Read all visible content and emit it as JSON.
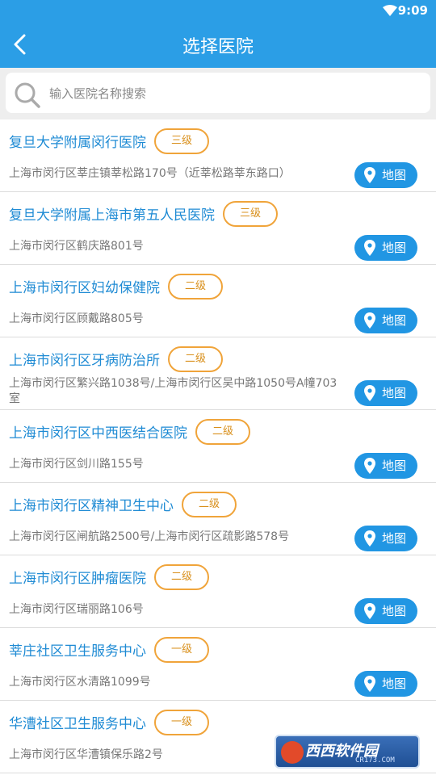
{
  "status_bar": {
    "time": "9:09"
  },
  "header": {
    "title": "选择医院",
    "back_icon": "back-arrow-icon"
  },
  "search": {
    "placeholder": "输入医院名称搜索",
    "value": ""
  },
  "hospitals": [
    {
      "name": "复旦大学附属闵行医院",
      "level": "三级",
      "address": "上海市闵行区莘庄镇莘松路170号（近莘松路莘东路口）",
      "map_label": "地图"
    },
    {
      "name": "复旦大学附属上海市第五人民医院",
      "level": "三级",
      "address": "上海市闵行区鹤庆路801号",
      "map_label": "地图"
    },
    {
      "name": "上海市闵行区妇幼保健院",
      "level": "二级",
      "address": "上海市闵行区顾戴路805号",
      "map_label": "地图"
    },
    {
      "name": "上海市闵行区牙病防治所",
      "level": "二级",
      "address": "上海市闵行区繁兴路1038号/上海市闵行区吴中路1050号A幢703室",
      "map_label": "地图"
    },
    {
      "name": "上海市闵行区中西医结合医院",
      "level": "二级",
      "address": "上海市闵行区剑川路155号",
      "map_label": "地图"
    },
    {
      "name": "上海市闵行区精神卫生中心",
      "level": "二级",
      "address": "上海市闵行区闸航路2500号/上海市闵行区疏影路578号",
      "map_label": "地图"
    },
    {
      "name": "上海市闵行区肿瘤医院",
      "level": "二级",
      "address": "上海市闵行区瑞丽路106号",
      "map_label": "地图"
    },
    {
      "name": "莘庄社区卫生服务中心",
      "level": "一级",
      "address": "上海市闵行区水清路1099号",
      "map_label": "地图"
    },
    {
      "name": "华漕社区卫生服务中心",
      "level": "一级",
      "address": "上海市闵行区华漕镇保乐路2号",
      "map_label": ""
    }
  ],
  "watermark": {
    "text": "西西软件园",
    "sub": "CR173.COM"
  },
  "colors": {
    "accent": "#2b9ee6",
    "badge_border": "#f0a43a",
    "name_text": "#1f8bd4"
  }
}
